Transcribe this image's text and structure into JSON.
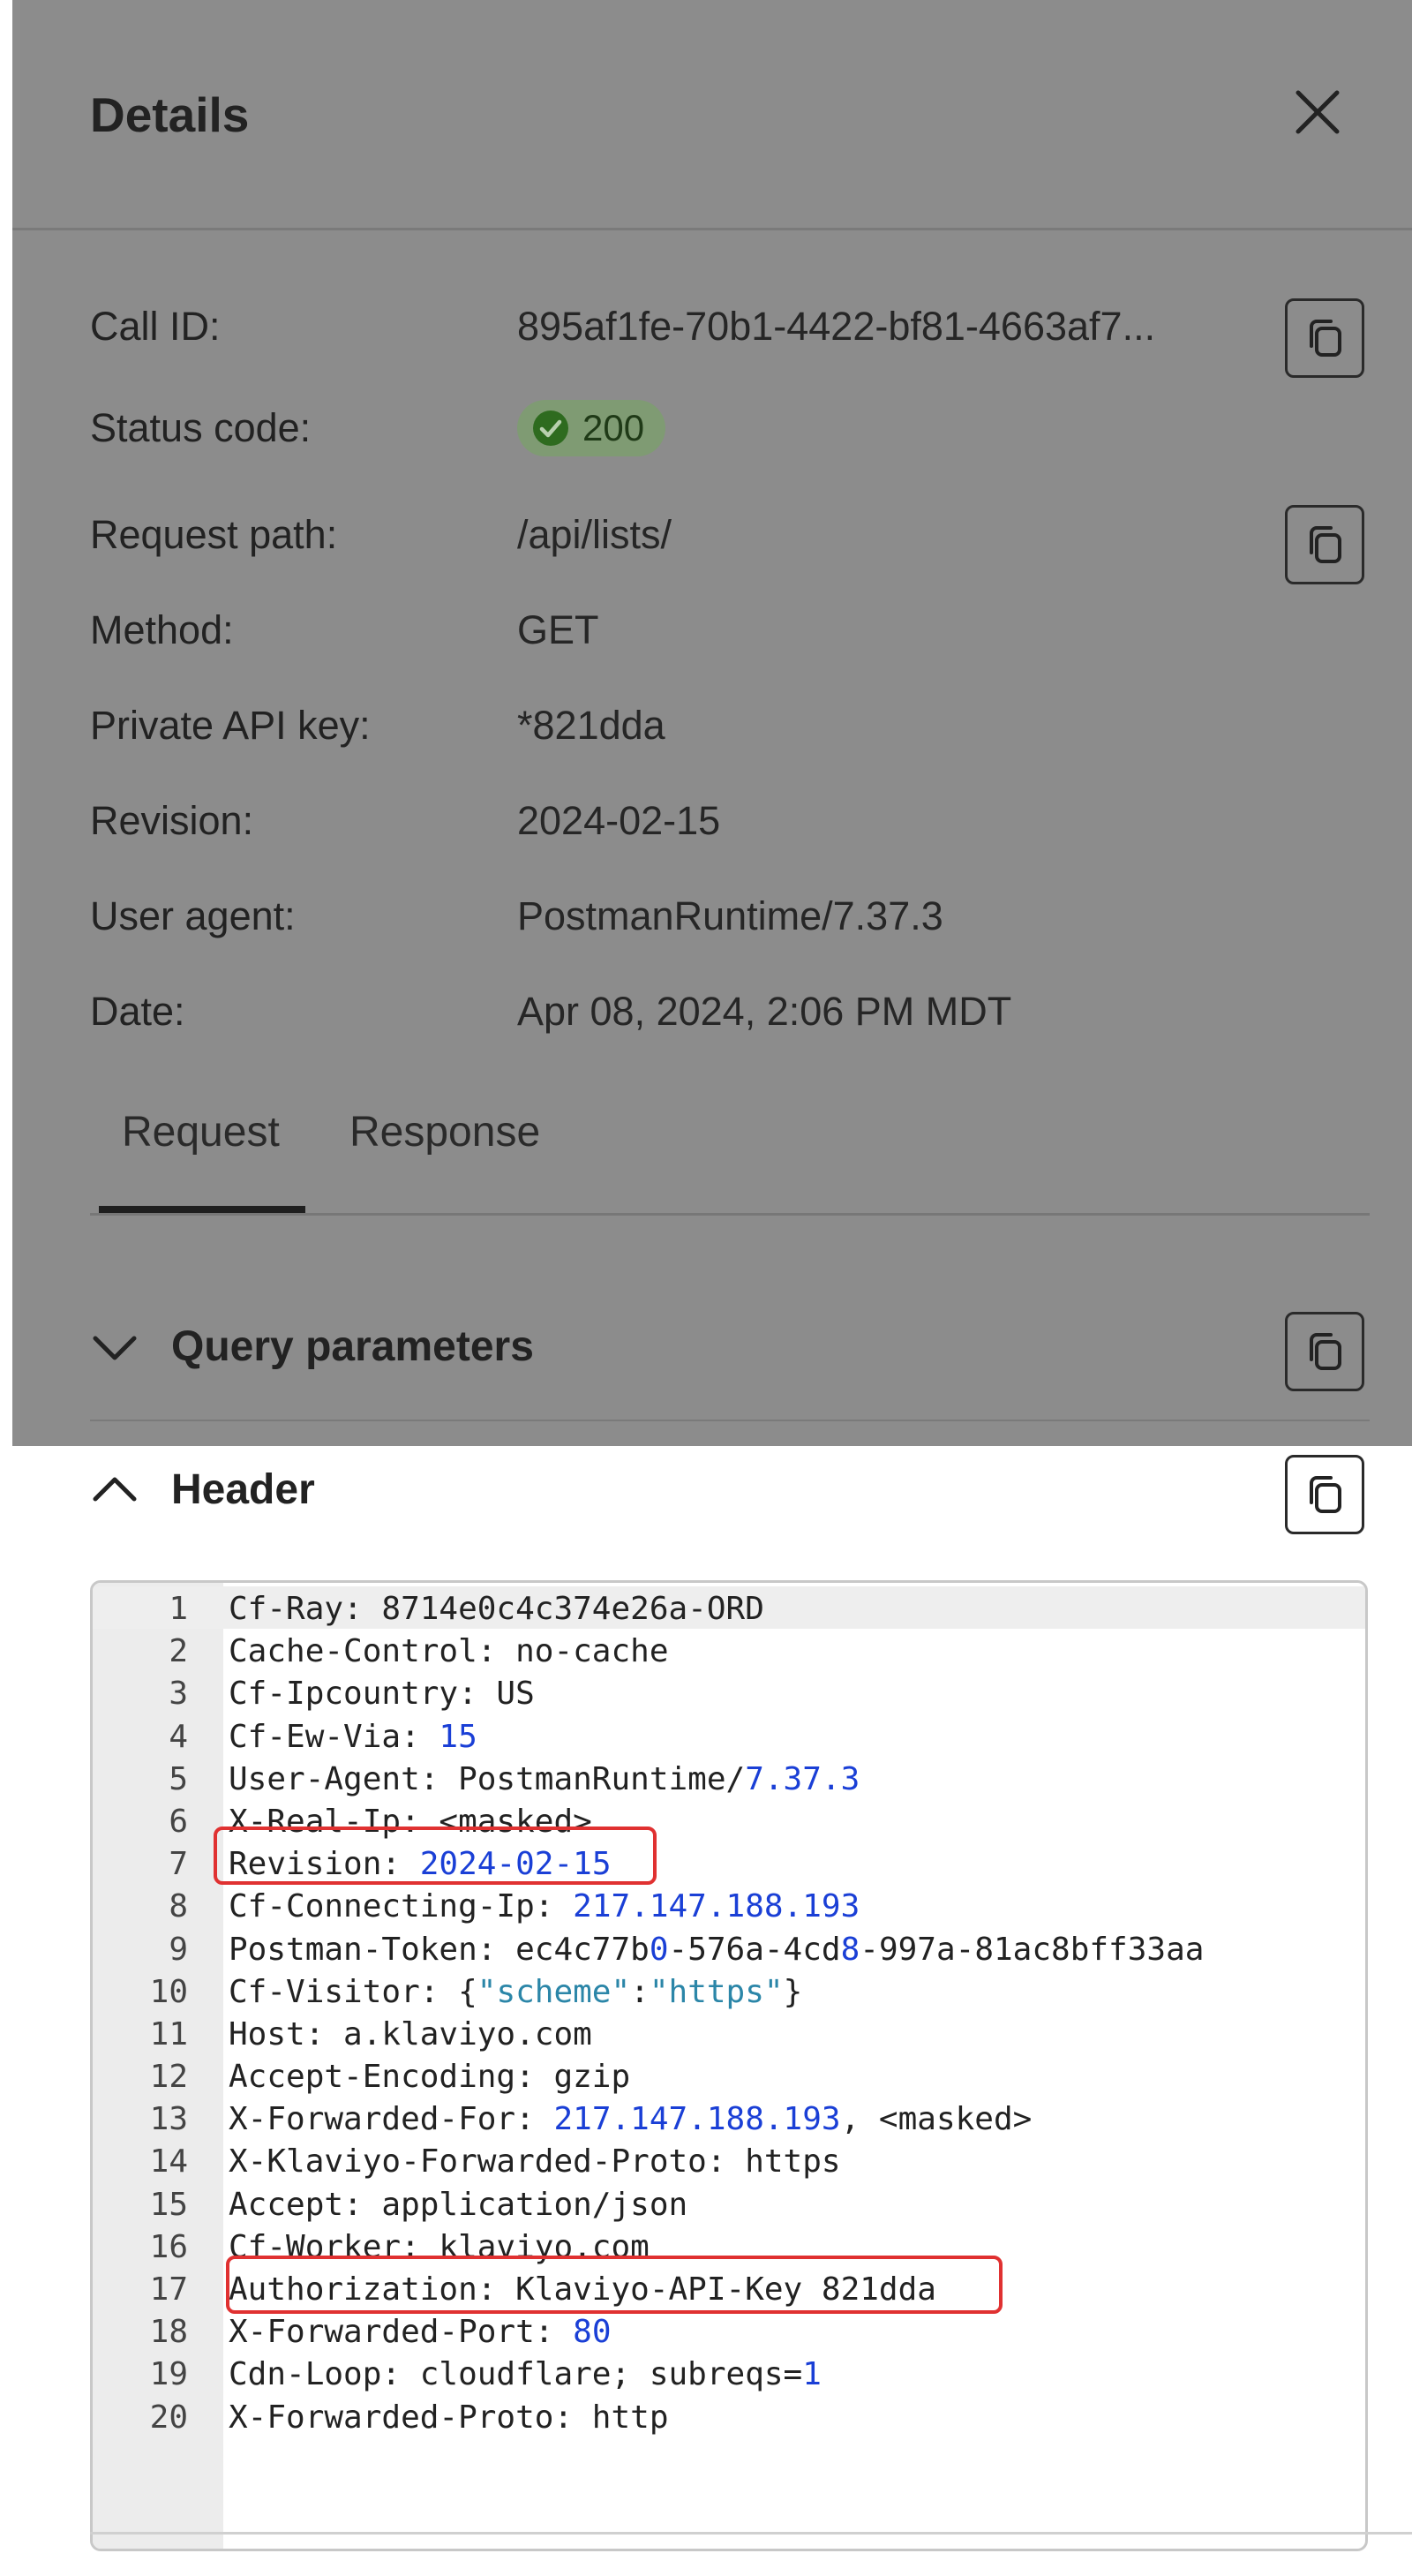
{
  "panel": {
    "title": "Details"
  },
  "details": {
    "call_id": {
      "label": "Call ID:",
      "value": "895af1fe-70b1-4422-bf81-4663af7..."
    },
    "status_code": {
      "label": "Status code:",
      "value": "200",
      "color": "#2e8b1f"
    },
    "request_path": {
      "label": "Request path:",
      "value": "/api/lists/"
    },
    "method": {
      "label": "Method:",
      "value": "GET"
    },
    "private_api_key": {
      "label": "Private API key:",
      "value": "*821dda"
    },
    "revision": {
      "label": "Revision:",
      "value": "2024-02-15"
    },
    "user_agent": {
      "label": "User agent:",
      "value": "PostmanRuntime/7.37.3"
    },
    "date": {
      "label": "Date:",
      "value": "Apr 08, 2024, 2:06 PM MDT"
    }
  },
  "tabs": [
    {
      "label": "Request",
      "selected": true
    },
    {
      "label": "Response",
      "selected": false
    }
  ],
  "sections": {
    "query_parameters": {
      "label": "Query parameters",
      "expanded": false
    },
    "header": {
      "label": "Header",
      "expanded": true
    }
  },
  "header_lines": [
    {
      "n": "1",
      "parts": [
        [
          "Cf-Ray: 8714e0c4c374e26a-ORD",
          "t"
        ]
      ]
    },
    {
      "n": "2",
      "parts": [
        [
          "Cache-Control: no-cache",
          "t"
        ]
      ]
    },
    {
      "n": "3",
      "parts": [
        [
          "Cf-Ipcountry: US",
          "t"
        ]
      ]
    },
    {
      "n": "4",
      "parts": [
        [
          "Cf-Ew-Via: ",
          "t"
        ],
        [
          "15",
          "n"
        ]
      ]
    },
    {
      "n": "5",
      "parts": [
        [
          "User-Agent: PostmanRuntime/",
          "t"
        ],
        [
          "7.37.3",
          "n"
        ]
      ]
    },
    {
      "n": "6",
      "parts": [
        [
          "X-Real-Ip: <masked>",
          "t"
        ]
      ]
    },
    {
      "n": "7",
      "parts": [
        [
          "Revision: ",
          "t"
        ],
        [
          "2024-02-15",
          "n"
        ]
      ]
    },
    {
      "n": "8",
      "parts": [
        [
          "Cf-Connecting-Ip: ",
          "t"
        ],
        [
          "217.147.188.193",
          "n"
        ]
      ]
    },
    {
      "n": "9",
      "parts": [
        [
          "Postman-Token: ec4c77b",
          "t"
        ],
        [
          "0",
          "n"
        ],
        [
          "-576a-4cd",
          "t"
        ],
        [
          "8",
          "n"
        ],
        [
          "-997a-81ac8bff33aa",
          "t"
        ]
      ]
    },
    {
      "n": "10",
      "parts": [
        [
          "Cf-Visitor: {",
          "t"
        ],
        [
          "\"scheme\"",
          "s"
        ],
        [
          ":",
          "t"
        ],
        [
          "\"https\"",
          "s"
        ],
        [
          "}",
          "t"
        ]
      ]
    },
    {
      "n": "11",
      "parts": [
        [
          "Host: a.klaviyo.com",
          "t"
        ]
      ]
    },
    {
      "n": "12",
      "parts": [
        [
          "Accept-Encoding: gzip",
          "t"
        ]
      ]
    },
    {
      "n": "13",
      "parts": [
        [
          "X-Forwarded-For: ",
          "t"
        ],
        [
          "217.147.188.193",
          "n"
        ],
        [
          ", <masked>",
          "t"
        ]
      ]
    },
    {
      "n": "14",
      "parts": [
        [
          "X-Klaviyo-Forwarded-Proto: https",
          "t"
        ]
      ]
    },
    {
      "n": "15",
      "parts": [
        [
          "Accept: application/json",
          "t"
        ]
      ]
    },
    {
      "n": "16",
      "parts": [
        [
          "Cf-Worker: klaviyo.com",
          "t"
        ]
      ]
    },
    {
      "n": "17",
      "parts": [
        [
          "Authorization: Klaviyo-API-Key 821dda",
          "t"
        ]
      ]
    },
    {
      "n": "18",
      "parts": [
        [
          "X-Forwarded-Port: ",
          "t"
        ],
        [
          "80",
          "n"
        ]
      ]
    },
    {
      "n": "19",
      "parts": [
        [
          "Cdn-Loop: cloudflare; subreqs=",
          "t"
        ],
        [
          "1",
          "n"
        ]
      ]
    },
    {
      "n": "20",
      "parts": [
        [
          "X-Forwarded-Proto: http",
          "t"
        ]
      ]
    }
  ],
  "colors": {
    "overlay": "#8c8c8c",
    "callout": "#e03131",
    "number": "#1a3fd6",
    "string": "#2b86a8"
  }
}
